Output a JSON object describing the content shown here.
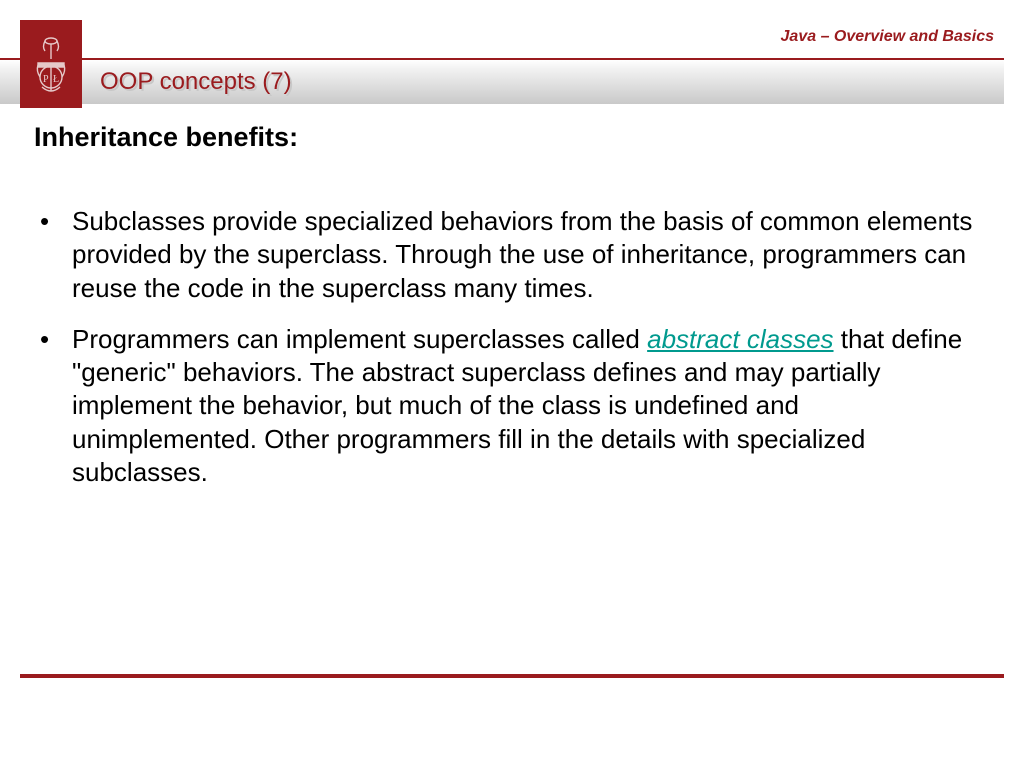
{
  "header": {
    "course_label": "Java – Overview and Basics",
    "slide_title": "OOP concepts (7)"
  },
  "content": {
    "heading": "Inheritance benefits:",
    "bullets": [
      {
        "text": "Subclasses provide specialized behaviors from the basis of common elements provided by the superclass. Through the use of inheritance, programmers can reuse the code in the superclass many times."
      },
      {
        "pre": "Programmers can implement superclasses called ",
        "link": "abstract classes",
        "post": " that define \"generic\" behaviors. The abstract superclass defines and may partially implement the behavior, but much of the class is undefined and unimplemented. Other programmers fill in the details with specialized subclasses."
      }
    ]
  }
}
